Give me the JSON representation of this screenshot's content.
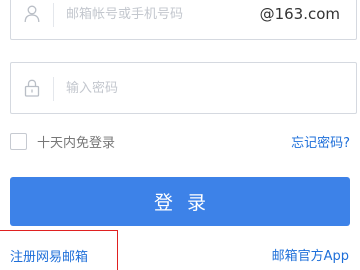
{
  "username": {
    "placeholder": "邮箱帐号或手机号码",
    "value": "",
    "suffix": "@163.com"
  },
  "password": {
    "placeholder": "输入密码",
    "value": ""
  },
  "remember_label": "十天内免登录",
  "forgot_label": "忘记密码?",
  "login_label": "登录",
  "register_label": "注册网易邮箱",
  "app_label": "邮箱官方App",
  "icons": {
    "user": "user-icon",
    "lock": "lock-icon"
  },
  "colors": {
    "primary": "#3d82e8",
    "link": "#1e6fd9",
    "highlight_box": "#e02020"
  }
}
